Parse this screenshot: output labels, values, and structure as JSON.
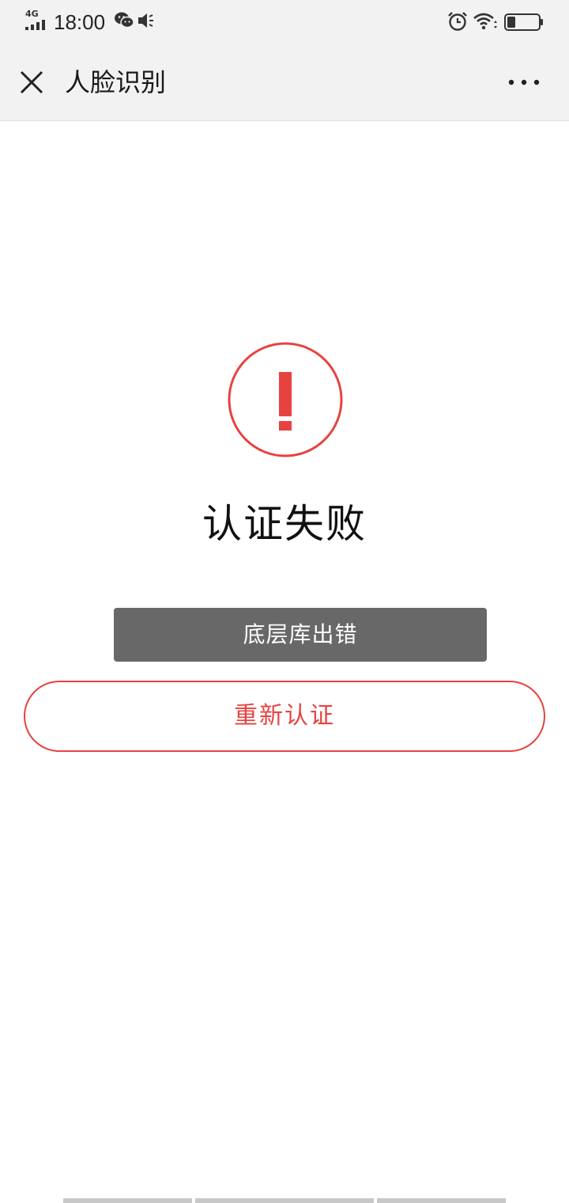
{
  "status_bar": {
    "network": "4G",
    "time": "18:00"
  },
  "nav": {
    "title": "人脸识别",
    "close_icon": "close-icon",
    "more_icon": "more-icon"
  },
  "result": {
    "icon": "exclamation-circle-icon",
    "title": "认证失败",
    "error_message": "底层库出错",
    "retry_label": "重新认证"
  },
  "colors": {
    "accent_red": "#e64340",
    "error_box": "#686868",
    "nav_bg": "#f2f2f2"
  }
}
